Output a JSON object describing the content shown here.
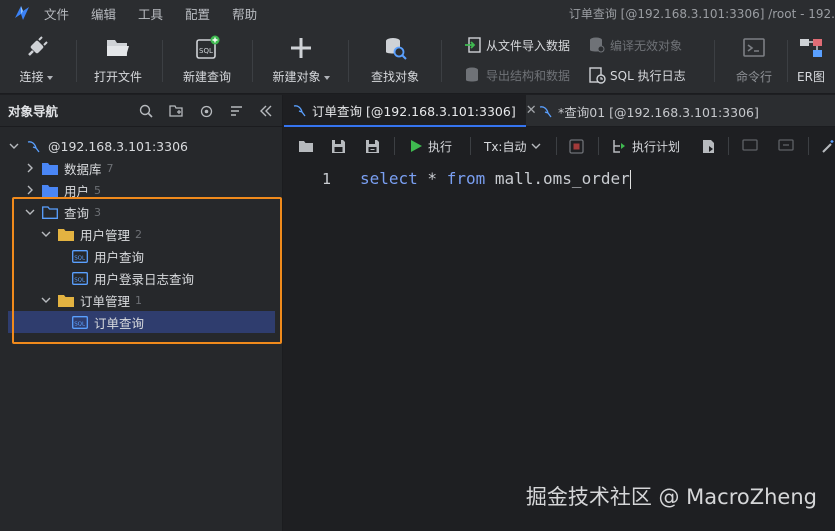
{
  "menu": {
    "items": [
      "文件",
      "编辑",
      "工具",
      "配置",
      "帮助"
    ],
    "window_title": "订单查询 [@192.168.3.101:3306] /root - 192."
  },
  "toolbar": {
    "connect": "连接",
    "open_file": "打开文件",
    "new_query": "新建查询",
    "new_object": "新建对象",
    "find_object": "查找对象",
    "import_from_file": "从文件导入数据",
    "export_structure": "导出结构和数据",
    "compile_invalid": "编译无效对象",
    "sql_log": "SQL 执行日志",
    "command_line": "命令行",
    "er_diagram": "ER图"
  },
  "navigator": {
    "title": "对象导航",
    "connection": "@192.168.3.101:3306",
    "databases": {
      "label": "数据库",
      "count": "7"
    },
    "users": {
      "label": "用户",
      "count": "5"
    },
    "queries": {
      "label": "查询",
      "count": "3"
    },
    "folder_user": {
      "label": "用户管理",
      "count": "2"
    },
    "user_query": "用户查询",
    "user_login_log_query": "用户登录日志查询",
    "folder_order": {
      "label": "订单管理",
      "count": "1"
    },
    "order_query": "订单查询"
  },
  "tabs": [
    {
      "label": "订单查询 [@192.168.3.101:3306]",
      "close": "✕"
    },
    {
      "label": "*查询01 [@192.168.3.101:3306]"
    }
  ],
  "editor_toolbar": {
    "execute": "执行",
    "tx_mode": "Tx:自动",
    "explain_plan": "执行计划"
  },
  "editor": {
    "line_number": "1",
    "kw_select": "select",
    "star": " * ",
    "kw_from": "from",
    "table": " mall.oms_order"
  },
  "watermark": "掘金技术社区 @ MacroZheng",
  "colors": {
    "accent": "#3574f0",
    "highlight_box": "#f08a1c",
    "keyword": "#7a9ff2",
    "selected_row": "#2f3d6e",
    "execute_green": "#3fb950"
  }
}
